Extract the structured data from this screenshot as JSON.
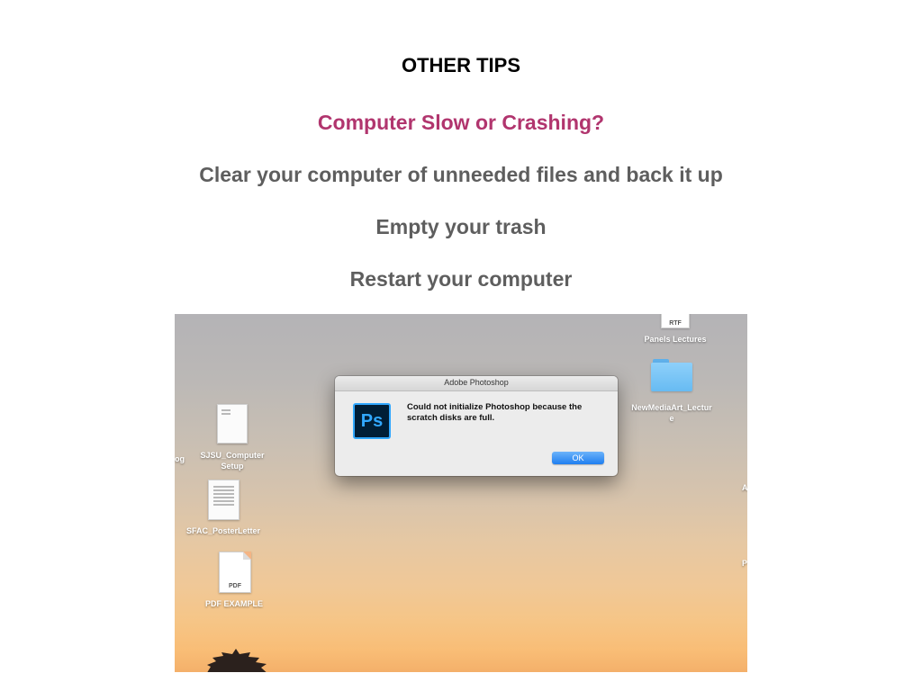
{
  "slide": {
    "title": "OTHER TIPS",
    "subtitle": "Computer Slow or Crashing?",
    "tips": [
      "Clear your computer of unneeded files and back it up",
      "Empty your trash",
      "Restart your computer"
    ],
    "colors": {
      "title": "#000000",
      "subtitle": "#b1356e",
      "tips": "#5e5e5e"
    }
  },
  "desktop": {
    "icons": [
      {
        "label": "Panels Lectures",
        "ext": "RTF",
        "icon": "rtf-document-icon"
      },
      {
        "label": "NewMediaArt_Lecture",
        "icon": "folder-icon"
      },
      {
        "label": "SJSU_Computer Setup",
        "icon": "document-icon"
      },
      {
        "label": "SFAC_PosterLetter",
        "icon": "document-icon"
      },
      {
        "label": "PDF EXAMPLE",
        "ext": "PDF",
        "icon": "pdf-document-icon"
      }
    ],
    "edge_fragments": {
      "left": "og",
      "right_a": "A",
      "right_b": "P"
    }
  },
  "dialog": {
    "title": "Adobe Photoshop",
    "icon": "photoshop-icon",
    "icon_text": "Ps",
    "message": "Could not initialize Photoshop because the scratch disks are full.",
    "ok_label": "OK",
    "accent": "#1f7ef0"
  }
}
